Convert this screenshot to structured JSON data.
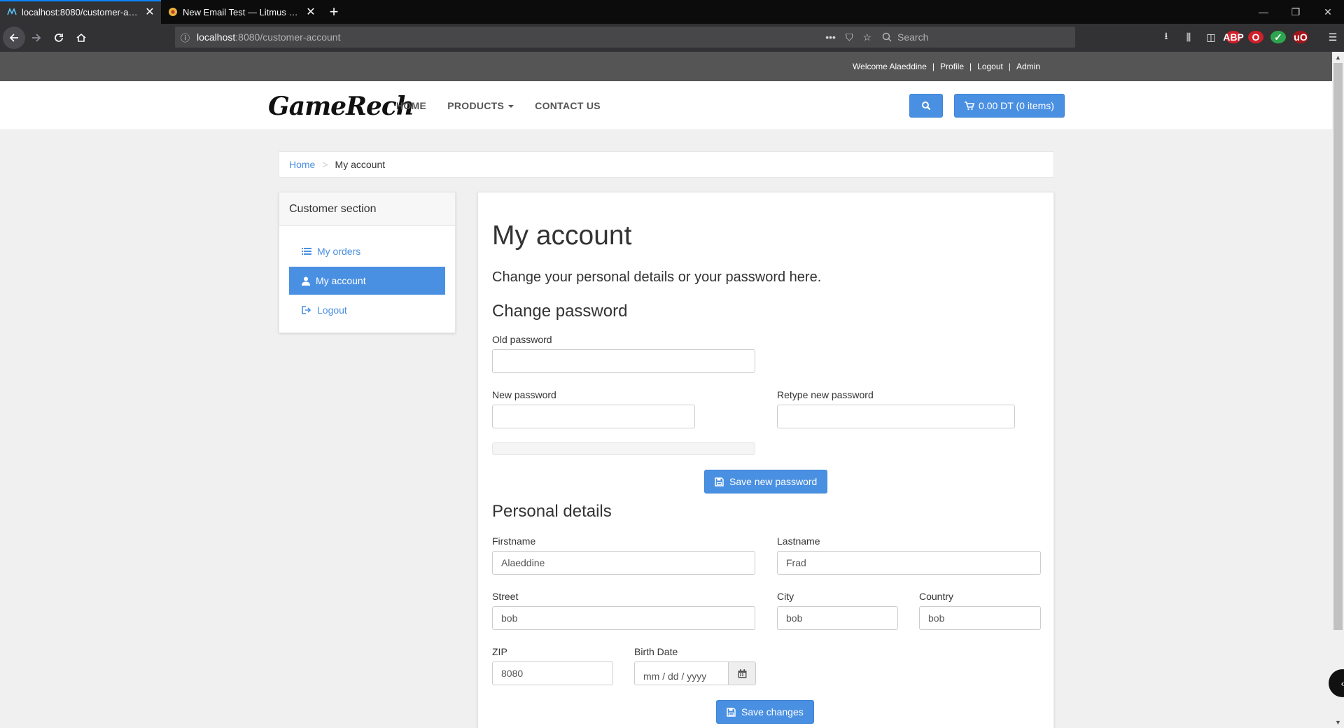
{
  "browser": {
    "tabs": [
      {
        "title": "localhost:8080/customer-account",
        "active": true
      },
      {
        "title": "New Email Test — Litmus Putsmail",
        "active": false
      }
    ],
    "url_host": "localhost",
    "url_path": ":8080/customer-account",
    "search_placeholder": "Search"
  },
  "topbar": {
    "welcome": "Welcome Alaeddine",
    "links": [
      "Profile",
      "Logout",
      "Admin"
    ]
  },
  "header": {
    "logo": "GameRech",
    "nav": [
      "HOME",
      "PRODUCTS",
      "CONTACT US"
    ],
    "cart_label": "0.00 DT (0 items)"
  },
  "breadcrumb": {
    "home": "Home",
    "current": "My account"
  },
  "sidebar": {
    "title": "Customer section",
    "items": [
      {
        "label": "My orders",
        "icon": "list-icon",
        "active": false
      },
      {
        "label": "My account",
        "icon": "user-icon",
        "active": true
      },
      {
        "label": "Logout",
        "icon": "sign-out-icon",
        "active": false
      }
    ]
  },
  "account": {
    "title": "My account",
    "lead": "Change your personal details or your password here.",
    "change_password": {
      "heading": "Change password",
      "old_label": "Old password",
      "new_label": "New password",
      "retype_label": "Retype new password",
      "save_label": "Save new password"
    },
    "personal": {
      "heading": "Personal details",
      "firstname_label": "Firstname",
      "firstname": "Alaeddine",
      "lastname_label": "Lastname",
      "lastname": "Frad",
      "street_label": "Street",
      "street": "bob",
      "city_label": "City",
      "city": "bob",
      "country_label": "Country",
      "country": "bob",
      "zip_label": "ZIP",
      "zip": "8080",
      "birth_label": "Birth Date",
      "birth_placeholder": "mm / dd / yyyy",
      "save_label": "Save changes"
    }
  },
  "colors": {
    "primary": "#4a90e2",
    "topbar": "#555555",
    "chrome_dark": "#0c0c0d",
    "chrome_toolbar": "#323234"
  }
}
